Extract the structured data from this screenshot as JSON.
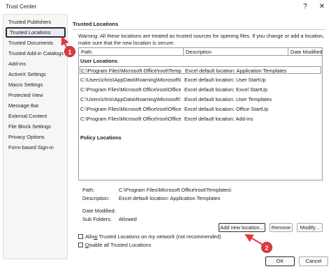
{
  "window": {
    "title": "Trust Center",
    "help_label": "?",
    "close_label": "✕"
  },
  "sidebar": {
    "items": [
      {
        "label": "Trusted Publishers"
      },
      {
        "label": "Trusted Locations"
      },
      {
        "label": "Trusted Documents"
      },
      {
        "label": "Trusted Add-in Catalogs"
      },
      {
        "label": "Add-ins"
      },
      {
        "label": "ActiveX Settings"
      },
      {
        "label": "Macro Settings"
      },
      {
        "label": "Protected View"
      },
      {
        "label": "Message Bar"
      },
      {
        "label": "External Content"
      },
      {
        "label": "File Block Settings"
      },
      {
        "label": "Privacy Options"
      },
      {
        "label": "Form-based Sign-in"
      }
    ],
    "selected_index": 1
  },
  "markers": {
    "one": "1",
    "two": "2"
  },
  "main": {
    "section_title": "Trusted Locations",
    "warning": "Warning: All these locations are treated as trusted sources for opening files.  If you change or add a location, make sure that the new location is secure.",
    "table": {
      "headers": {
        "path": "Path",
        "description": "Description",
        "date_modified": "Date Modified"
      },
      "user_locations_label": "User Locations",
      "policy_locations_label": "Policy Locations",
      "rows": [
        {
          "path": "C:\\Program Files\\Microsoft Office\\root\\Templa",
          "description": "Excel default location: Application Templates",
          "date": ""
        },
        {
          "path": "C:\\Users\\chris\\AppData\\Roaming\\Microsoft\\E",
          "description": "Excel default location: User StartUp",
          "date": ""
        },
        {
          "path": "C:\\Program Files\\Microsoft Office\\root\\Office1",
          "description": "Excel default location: Excel StartUp",
          "date": ""
        },
        {
          "path": "C:\\Users\\chris\\AppData\\Roaming\\Microsoft\\T",
          "description": "Excel default location: User Templates",
          "date": ""
        },
        {
          "path": "C:\\Program Files\\Microsoft Office\\root\\Office1",
          "description": "Excel default location: Office StartUp",
          "date": ""
        },
        {
          "path": "C:\\Program Files\\Microsoft Office\\root\\Office1",
          "description": "Excel default location: Add-ins",
          "date": ""
        }
      ]
    },
    "details": {
      "path_label": "Path:",
      "path_value": "C:\\Program Files\\Microsoft Office\\root\\Templates\\",
      "description_label": "Description:",
      "description_value": "Excel default location: Application Templates",
      "date_label": "Date Modified:",
      "date_value": "",
      "subfolders_label": "Sub Folders:",
      "subfolders_value": "Allowed"
    },
    "buttons": {
      "add": "Add new location...",
      "remove": "Remove",
      "modify": "Modify..."
    },
    "checkboxes": {
      "allow_network": {
        "prefix": "Allo",
        "underline": "w",
        "suffix": " Trusted Locations on my network (not recommended)",
        "checked": false
      },
      "disable_all": {
        "prefix": "",
        "underline": "D",
        "suffix": "isable all Trusted Locations",
        "checked": false
      }
    }
  },
  "footer": {
    "ok": "OK",
    "cancel": "Cancel"
  },
  "colors": {
    "marker": "#e0383e",
    "selected_bg": "#e6ecf4"
  }
}
